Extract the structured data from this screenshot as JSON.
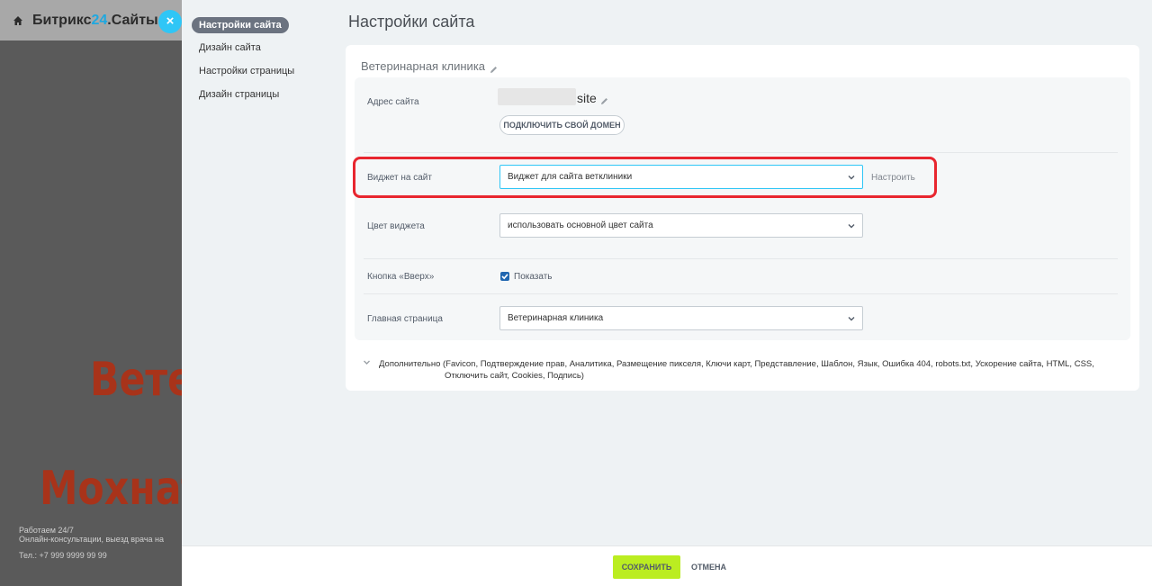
{
  "background_site": {
    "brand_prefix": "Битрикс",
    "brand_number": "24",
    "brand_suffix": ".Сайты",
    "close_symbol": "×",
    "hero_line1": "Вете",
    "hero_line2": "Мохнат",
    "hours": "Работаем 24/7",
    "services": "Онлайн-консультации, выезд врача на",
    "phone": "Тел.: +7 999 9999 99 99"
  },
  "nav": {
    "items": [
      {
        "label": "Настройки сайта"
      },
      {
        "label": "Дизайн сайта"
      },
      {
        "label": "Настройки страницы"
      },
      {
        "label": "Дизайн страницы"
      }
    ]
  },
  "page": {
    "title": "Настройки сайта",
    "site_name": "Ветеринарная клиника"
  },
  "fields": {
    "address_label": "Адрес сайта",
    "address_suffix": "site",
    "domain_button": "ПОДКЛЮЧИТЬ СВОЙ ДОМЕН",
    "widget_label": "Виджет на сайт",
    "widget_value": "Виджет для сайта ветклиники",
    "widget_setup": "Настроить",
    "color_label": "Цвет виджета",
    "color_value": "использовать основной цвет сайта",
    "up_label": "Кнопка «Вверх»",
    "up_checkbox_label": "Показать",
    "up_checked": true,
    "home_label": "Главная страница",
    "home_value": "Ветеринарная клиника"
  },
  "more": {
    "line1": "Дополнительно (Favicon, Подтверждение прав, Аналитика, Размещение пикселя, Ключи карт, Представление, Шаблон, Язык, Ошибка 404, robots.txt, Ускорение сайта, HTML, CSS,",
    "line2": "Отключить сайт, Cookies, Подпись)"
  },
  "footer": {
    "save": "СОХРАНИТЬ",
    "cancel": "ОТМЕНА"
  },
  "colors": {
    "accent_blue": "#2fc6f6",
    "save_green": "#bbed21",
    "highlight_red": "#e8262f"
  }
}
